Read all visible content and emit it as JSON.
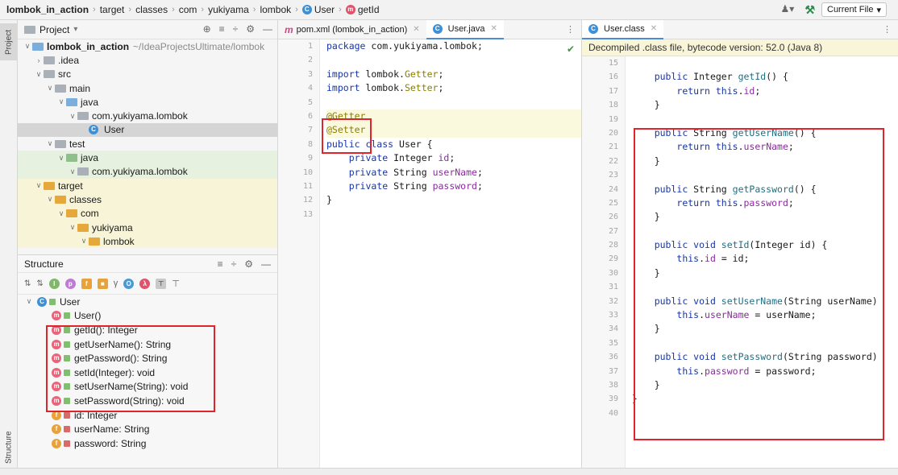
{
  "breadcrumb": [
    "lombok_in_action",
    "target",
    "classes",
    "com",
    "yukiyama",
    "lombok",
    "User",
    "getId"
  ],
  "run_config": "Current File",
  "tool_windows": {
    "project_tab": "Project",
    "structure_tab": "Structure"
  },
  "project_panel": {
    "title": "Project",
    "tree": [
      {
        "label": "lombok_in_action",
        "path": "~/IdeaProjectsUltimate/lombok",
        "depth": 0,
        "open": true,
        "icon": "module-folder",
        "bold": true
      },
      {
        "label": ".idea",
        "depth": 1,
        "open": false,
        "icon": "folder-grey"
      },
      {
        "label": "src",
        "depth": 1,
        "open": true,
        "icon": "folder-grey"
      },
      {
        "label": "main",
        "depth": 2,
        "open": true,
        "icon": "folder-grey"
      },
      {
        "label": "java",
        "depth": 3,
        "open": true,
        "icon": "folder-blue"
      },
      {
        "label": "com.yukiyama.lombok",
        "depth": 4,
        "open": true,
        "icon": "package"
      },
      {
        "label": "User",
        "depth": 5,
        "icon": "class",
        "selected": true
      },
      {
        "label": "test",
        "depth": 2,
        "open": true,
        "icon": "folder-grey"
      },
      {
        "label": "java",
        "depth": 3,
        "open": true,
        "icon": "folder-green",
        "tint": "green"
      },
      {
        "label": "com.yukiyama.lombok",
        "depth": 4,
        "open": true,
        "icon": "package",
        "tint": "green"
      },
      {
        "label": "target",
        "depth": 1,
        "open": true,
        "icon": "folder-orange",
        "tint": "yellow"
      },
      {
        "label": "classes",
        "depth": 2,
        "open": true,
        "icon": "folder-orange",
        "tint": "yellow"
      },
      {
        "label": "com",
        "depth": 3,
        "open": true,
        "icon": "folder-orange",
        "tint": "yellow"
      },
      {
        "label": "yukiyama",
        "depth": 4,
        "open": true,
        "icon": "folder-orange",
        "tint": "yellow"
      },
      {
        "label": "lombok",
        "depth": 5,
        "open": true,
        "icon": "folder-orange",
        "tint": "yellow"
      }
    ]
  },
  "structure_panel": {
    "title": "Structure",
    "root": "User",
    "members": [
      {
        "label": "User()",
        "kind": "method"
      },
      {
        "label": "getId(): Integer",
        "kind": "method"
      },
      {
        "label": "getUserName(): String",
        "kind": "method"
      },
      {
        "label": "getPassword(): String",
        "kind": "method"
      },
      {
        "label": "setId(Integer): void",
        "kind": "method"
      },
      {
        "label": "setUserName(String): void",
        "kind": "method"
      },
      {
        "label": "setPassword(String): void",
        "kind": "method"
      },
      {
        "label": "id: Integer",
        "kind": "field"
      },
      {
        "label": "userName: String",
        "kind": "field"
      },
      {
        "label": "password: String",
        "kind": "field"
      }
    ]
  },
  "editor_left": {
    "tabs": [
      {
        "label": "pom.xml (lombok_in_action)",
        "icon": "m",
        "active": false
      },
      {
        "label": "User.java",
        "icon": "c",
        "active": true
      }
    ],
    "lines": [
      {
        "n": "1",
        "segs": [
          [
            "kw",
            "package "
          ],
          [
            "",
            "com.yukiyama.lombok;"
          ]
        ]
      },
      {
        "n": "2",
        "segs": []
      },
      {
        "n": "3",
        "segs": [
          [
            "kw",
            "import "
          ],
          [
            "",
            "lombok."
          ],
          [
            "ann",
            "Getter"
          ],
          [
            "",
            ";"
          ]
        ]
      },
      {
        "n": "4",
        "segs": [
          [
            "kw",
            "import "
          ],
          [
            "",
            "lombok."
          ],
          [
            "ann",
            "Setter"
          ],
          [
            "",
            ";"
          ]
        ]
      },
      {
        "n": "5",
        "segs": []
      },
      {
        "n": "6",
        "segs": [
          [
            "ann",
            "@Getter"
          ]
        ],
        "hl": true
      },
      {
        "n": "7",
        "segs": [
          [
            "ann",
            "@Setter"
          ]
        ],
        "hl": true
      },
      {
        "n": "8",
        "segs": [
          [
            "kw",
            "public class "
          ],
          [
            "",
            "User {"
          ]
        ]
      },
      {
        "n": "9",
        "segs": [
          [
            "",
            "    "
          ],
          [
            "kw",
            "private "
          ],
          [
            "",
            "Integer "
          ],
          [
            "fld",
            "id"
          ],
          [
            "",
            ";"
          ]
        ]
      },
      {
        "n": "10",
        "segs": [
          [
            "",
            "    "
          ],
          [
            "kw",
            "private "
          ],
          [
            "",
            "String "
          ],
          [
            "fld",
            "userName"
          ],
          [
            "",
            ";"
          ]
        ]
      },
      {
        "n": "11",
        "segs": [
          [
            "",
            "    "
          ],
          [
            "kw",
            "private "
          ],
          [
            "",
            "String "
          ],
          [
            "fld",
            "password"
          ],
          [
            "",
            ";"
          ]
        ]
      },
      {
        "n": "12",
        "segs": [
          [
            "",
            "}"
          ]
        ]
      },
      {
        "n": "13",
        "segs": []
      }
    ]
  },
  "editor_right": {
    "tabs": [
      {
        "label": "User.class",
        "icon": "c",
        "active": true
      }
    ],
    "banner": "Decompiled .class file, bytecode version: 52.0 (Java 8)",
    "lines": [
      {
        "n": "15",
        "segs": []
      },
      {
        "n": "16",
        "segs": [
          [
            "",
            "    "
          ],
          [
            "kw",
            "public "
          ],
          [
            "",
            "Integer "
          ],
          [
            "mtd",
            "getId"
          ],
          [
            "",
            "() {"
          ]
        ]
      },
      {
        "n": "17",
        "segs": [
          [
            "",
            "        "
          ],
          [
            "kw",
            "return this"
          ],
          [
            "",
            "."
          ],
          [
            "fld",
            "id"
          ],
          [
            "",
            ";"
          ]
        ]
      },
      {
        "n": "18",
        "segs": [
          [
            "",
            "    }"
          ]
        ]
      },
      {
        "n": "19",
        "segs": []
      },
      {
        "n": "20",
        "segs": [
          [
            "",
            "    "
          ],
          [
            "kw",
            "public "
          ],
          [
            "",
            "String "
          ],
          [
            "mtd",
            "getUserName"
          ],
          [
            "",
            "() {"
          ]
        ]
      },
      {
        "n": "21",
        "segs": [
          [
            "",
            "        "
          ],
          [
            "kw",
            "return this"
          ],
          [
            "",
            "."
          ],
          [
            "fld",
            "userName"
          ],
          [
            "",
            ";"
          ]
        ]
      },
      {
        "n": "22",
        "segs": [
          [
            "",
            "    }"
          ]
        ]
      },
      {
        "n": "23",
        "segs": []
      },
      {
        "n": "24",
        "segs": [
          [
            "",
            "    "
          ],
          [
            "kw",
            "public "
          ],
          [
            "",
            "String "
          ],
          [
            "mtd",
            "getPassword"
          ],
          [
            "",
            "() {"
          ]
        ]
      },
      {
        "n": "25",
        "segs": [
          [
            "",
            "        "
          ],
          [
            "kw",
            "return this"
          ],
          [
            "",
            "."
          ],
          [
            "fld",
            "password"
          ],
          [
            "",
            ";"
          ]
        ]
      },
      {
        "n": "26",
        "segs": [
          [
            "",
            "    }"
          ]
        ]
      },
      {
        "n": "27",
        "segs": []
      },
      {
        "n": "28",
        "segs": [
          [
            "",
            "    "
          ],
          [
            "kw",
            "public void "
          ],
          [
            "mtd",
            "setId"
          ],
          [
            "",
            "(Integer id) {"
          ]
        ]
      },
      {
        "n": "29",
        "segs": [
          [
            "",
            "        "
          ],
          [
            "kw",
            "this"
          ],
          [
            "",
            "."
          ],
          [
            "fld",
            "id"
          ],
          [
            "",
            " = id;"
          ]
        ]
      },
      {
        "n": "30",
        "segs": [
          [
            "",
            "    }"
          ]
        ]
      },
      {
        "n": "31",
        "segs": []
      },
      {
        "n": "32",
        "segs": [
          [
            "",
            "    "
          ],
          [
            "kw",
            "public void "
          ],
          [
            "mtd",
            "setUserName"
          ],
          [
            "",
            "(String userName)"
          ]
        ]
      },
      {
        "n": "33",
        "segs": [
          [
            "",
            "        "
          ],
          [
            "kw",
            "this"
          ],
          [
            "",
            "."
          ],
          [
            "fld",
            "userName"
          ],
          [
            "",
            " = userName;"
          ]
        ]
      },
      {
        "n": "34",
        "segs": [
          [
            "",
            "    }"
          ]
        ]
      },
      {
        "n": "35",
        "segs": []
      },
      {
        "n": "36",
        "segs": [
          [
            "",
            "    "
          ],
          [
            "kw",
            "public void "
          ],
          [
            "mtd",
            "setPassword"
          ],
          [
            "",
            "(String password)"
          ]
        ]
      },
      {
        "n": "37",
        "segs": [
          [
            "",
            "        "
          ],
          [
            "kw",
            "this"
          ],
          [
            "",
            "."
          ],
          [
            "fld",
            "password"
          ],
          [
            "",
            " = password;"
          ]
        ]
      },
      {
        "n": "38",
        "segs": [
          [
            "",
            "    }"
          ]
        ]
      },
      {
        "n": "39",
        "segs": [
          [
            "",
            "}"
          ]
        ]
      },
      {
        "n": "40",
        "segs": []
      }
    ]
  }
}
